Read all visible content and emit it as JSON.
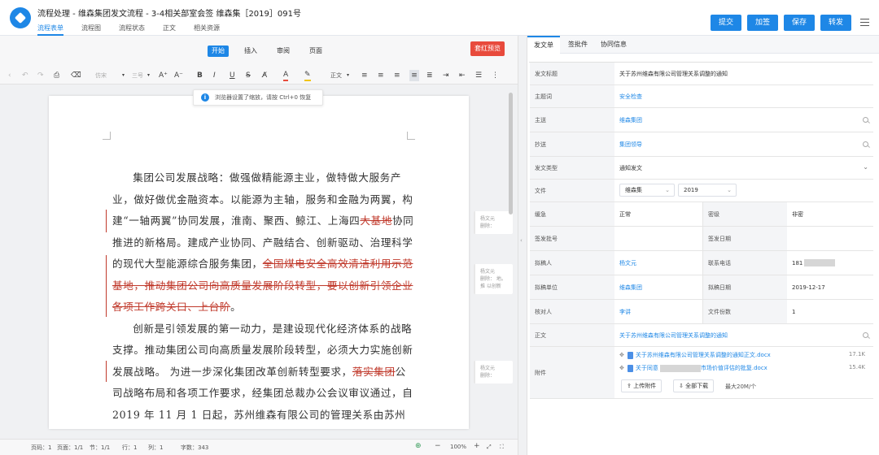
{
  "header": {
    "title": "流程处理 - 维森集团发文流程 - 3-4相关部室会签 维森集［2019］091号",
    "tabs": [
      {
        "label": "流程表单",
        "active": true
      },
      {
        "label": "流程图"
      },
      {
        "label": "流程状态"
      },
      {
        "label": "正文"
      },
      {
        "label": "相关资源"
      }
    ],
    "buttons": [
      "提交",
      "加签",
      "保存",
      "转发"
    ],
    "accent": "#1e87e6"
  },
  "editor": {
    "ribbon_tabs": [
      {
        "label": "开始",
        "active": true
      },
      {
        "label": "插入"
      },
      {
        "label": "审阅"
      },
      {
        "label": "页面"
      }
    ],
    "red_button": "套红预览",
    "font_name": "仿宋",
    "font_size": "三号",
    "style_name": "正文",
    "zoom_tip": "浏览器设置了缩放，请按 Ctrl+0 恢复",
    "paragraphs": [
      {
        "segments": [
          {
            "text": "集团公司发展战略：做强做精能源主业，做特做大服务产业，做好做优金融资本。以能源为主轴，服务和金融为两翼，构建“一轴两翼”协同发展，淮南、聚西、鲸江、上海四"
          },
          {
            "text": "大基地",
            "deleted": true
          },
          {
            "text": "协同推进的新格局。建成产业协同、产融结合、创新驱动、治理科学的现代大型能源综合服务集团，"
          },
          {
            "text": "全国煤电安全高效清洁利用示范基地，推动集团公司向高质量发展阶段转型，要以创新引领企业各项工作跨关口、上台阶",
            "deleted": true
          },
          {
            "text": "。"
          }
        ]
      },
      {
        "segments": [
          {
            "text": "创新是引领发展的第一动力，是建设现代化经济体系的战略支撑。推动集团公司向高质量发展阶段转型，必须大力实施创新发展战略。 为进一步深化集团改革创新转型要求，"
          },
          {
            "text": "落实集团",
            "deleted": true
          },
          {
            "text": "公司战略布局和各项工作要求，经集团总裁办公会议审议通过，自 2019 年 11 月 1 日起，苏州维森有限公司的管理关系由苏州"
          }
        ]
      }
    ],
    "comments": [
      {
        "title": "杨文元",
        "body": "删除："
      },
      {
        "title": "杨文元",
        "body": "删除： 地。推 以创新"
      },
      {
        "title": "杨文元",
        "body": "删除："
      }
    ],
    "status": {
      "page_code": "页码：1",
      "pages": "页面：1/1",
      "section": "节：1/1",
      "row": "行：1",
      "col": "列：1",
      "words": "字数：343",
      "zoom": "100%"
    }
  },
  "panel": {
    "tabs": [
      {
        "label": "发文单",
        "active": true
      },
      {
        "label": "签批件"
      },
      {
        "label": "协同信息"
      }
    ],
    "fields": {
      "subject_label": "发文标题",
      "subject_value": "关于苏州维森有限公司管理关系调整的通知",
      "keyword_label": "主题词",
      "keyword_value": "安全检查",
      "main_send_label": "主送",
      "main_send_value": "维森集团",
      "copy_label": "抄送",
      "copy_value": "集团领导",
      "type_label": "发文类型",
      "type_value": "通知发文",
      "docno_label": "文件",
      "docno_prefix": "维森集",
      "docno_year": "2019",
      "urgency_label": "缓急",
      "urgency_value": "正常",
      "secret_label": "密级",
      "secret_value": "非密",
      "sign_no_label": "签发批号",
      "sign_date_label": "签发日期",
      "drafter_label": "拟稿人",
      "drafter_value": "杨文元",
      "contact_label": "联系电话",
      "contact_value": "181",
      "dept_label": "拟稿单位",
      "dept_value": "维森集团",
      "draft_date_label": "拟稿日期",
      "draft_date_value": "2019-12-17",
      "checker_label": "核对人",
      "checker_value": "李讲",
      "copies_label": "文件份数",
      "copies_value": "1",
      "body_label": "正文",
      "body_value": "关于苏州维森有限公司管理关系调整的通知",
      "attach_label": "附件",
      "attachments": [
        {
          "name": "关于苏州维森有限公司管理关系调整的通知正文.docx",
          "size": "17.1K"
        },
        {
          "name": "关于同意",
          "name_tail": "市场价值评估的批复.docx",
          "size": "15.4K"
        }
      ],
      "upload_label": "上传附件",
      "download_label": "全部下载",
      "max_label": "最大20M/个"
    }
  }
}
